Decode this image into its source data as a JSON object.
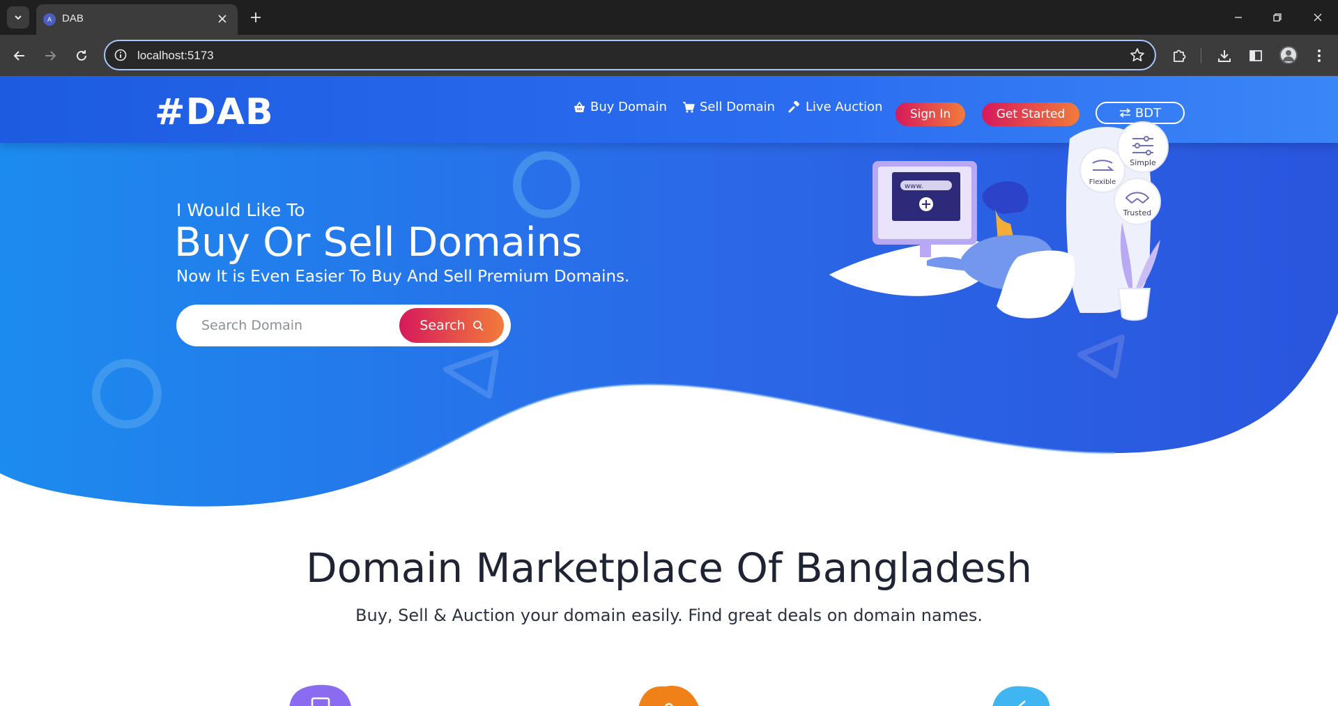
{
  "browser": {
    "tab_title": "DAB",
    "favicon_letter": "A",
    "url": "localhost:5173"
  },
  "site": {
    "logo": "#DAB",
    "nav": {
      "buy": "Buy Domain",
      "sell": "Sell Domain",
      "auction": "Live Auction"
    },
    "sign_in": "Sign In",
    "get_started": "Get Started",
    "currency": "BDT"
  },
  "hero": {
    "kicker": "I Would Like To",
    "title": "Buy Or Sell Domains",
    "subtitle": "Now It is Even Easier To Buy And Sell Premium Domains.",
    "search_placeholder": "Search Domain",
    "search_button": "Search",
    "illustration": {
      "url_text": "www.",
      "badges": [
        "Flexible",
        "Simple",
        "Trusted"
      ]
    }
  },
  "section": {
    "title": "Domain Marketplace Of Bangladesh",
    "subtitle": "Buy, Sell & Auction your domain easily. Find great deals on domain names."
  },
  "colors": {
    "header_blue": "#1d5ce0",
    "hero_blue_light": "#1f8ef0",
    "hero_blue_dark": "#2a63e6",
    "accent_pink": "#d6195b",
    "accent_orange": "#f27c3a",
    "feature_purple": "#8b6cf0",
    "feature_orange": "#f08018",
    "feature_cyan": "#3fb6f0"
  }
}
